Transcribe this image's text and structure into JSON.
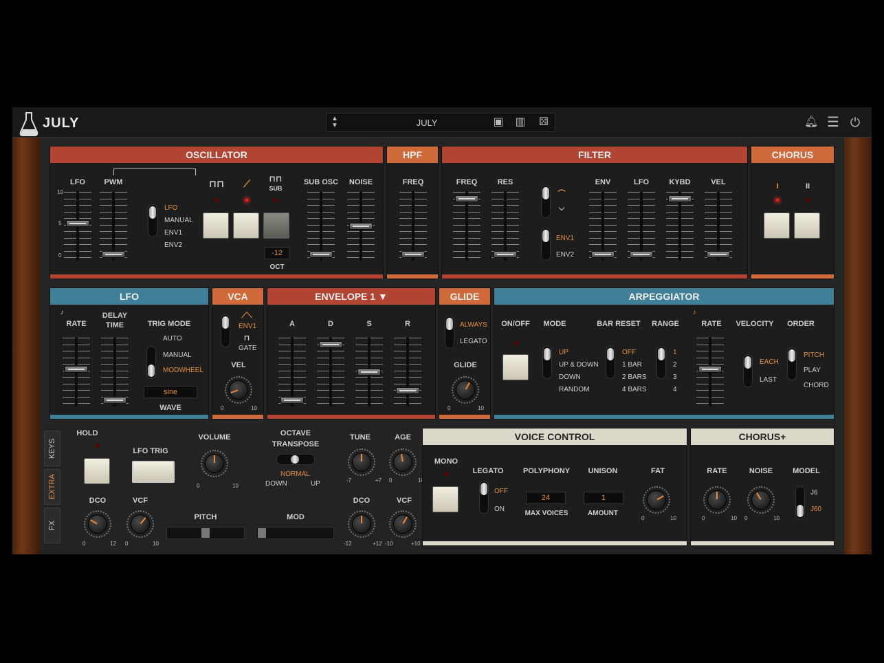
{
  "app": {
    "brand": "JULY",
    "preset_name": "JULY"
  },
  "osc": {
    "title": "OSCILLATOR",
    "lfo": "LFO",
    "pwm": "PWM",
    "sub": "SUB",
    "sub_osc": "SUB OSC",
    "noise": "NOISE",
    "src_lfo": "LFO",
    "src_manual": "MANUAL",
    "src_env1": "ENV1",
    "src_env2": "ENV2",
    "oct_value": "-12",
    "oct": "OCT",
    "n10": "10",
    "n5": "5",
    "n0": "0"
  },
  "hpf": {
    "title": "HPF",
    "freq": "FREQ"
  },
  "filter": {
    "title": "FILTER",
    "freq": "FREQ",
    "res": "RES",
    "env": "ENV",
    "lfo": "LFO",
    "kybd": "KYBD",
    "vel": "VEL",
    "env1": "ENV1",
    "env2": "ENV2"
  },
  "chorus": {
    "title": "CHORUS",
    "one": "I",
    "two": "II"
  },
  "lfo": {
    "title": "LFO",
    "rate": "RATE",
    "delay": "DELAY",
    "time": "TIME",
    "trig_mode": "TRIG MODE",
    "auto": "AUTO",
    "manual": "MANUAL",
    "modwheel": "MODWHEEL",
    "wave_value": "sine",
    "wave": "WAVE"
  },
  "vca": {
    "title": "VCA",
    "env1": "ENV1",
    "gate": "GATE",
    "vel": "VEL"
  },
  "env": {
    "title": "ENVELOPE 1",
    "a": "A",
    "d": "D",
    "s": "S",
    "r": "R"
  },
  "glide": {
    "title": "GLIDE",
    "always": "ALWAYS",
    "legato": "LEGATO",
    "glide": "GLIDE"
  },
  "arp": {
    "title": "ARPEGGIATOR",
    "onoff": "ON/OFF",
    "mode": "MODE",
    "up": "UP",
    "updown": "UP & DOWN",
    "down": "DOWN",
    "random": "RANDOM",
    "bar_reset": "BAR RESET",
    "off": "OFF",
    "bar1": "1 BAR",
    "bar2": "2 BARS",
    "bar4": "4 BARS",
    "range": "RANGE",
    "r1": "1",
    "r2": "2",
    "r3": "3",
    "r4": "4",
    "rate": "RATE",
    "velocity": "VELOCITY",
    "each": "EACH",
    "last": "LAST",
    "order": "ORDER",
    "pitch": "PITCH",
    "play": "PLAY",
    "chord": "CHORD"
  },
  "tabs": {
    "keys": "KEYS",
    "extra": "EXTRA",
    "fx": "FX"
  },
  "extra": {
    "hold": "HOLD",
    "lfo_trig": "LFO TRIG",
    "volume": "VOLUME",
    "dco": "DCO",
    "vcf": "VCF",
    "pitch": "PITCH",
    "octave": "OCTAVE",
    "transpose": "TRANSPOSE",
    "normal": "NORMAL",
    "down": "DOWN",
    "up": "UP",
    "tune": "TUNE",
    "age": "AGE",
    "mod": "MOD",
    "dco2": "DCO",
    "vcf2": "VCF",
    "n12": "12",
    "m7": "-7",
    "p7": "+7",
    "m12": "-12",
    "p12": "+12",
    "m10": "-10",
    "p10": "+10"
  },
  "voice": {
    "title": "VOICE CONTROL",
    "mono": "MONO",
    "legato": "LEGATO",
    "off": "OFF",
    "on": "ON",
    "polyphony": "POLYPHONY",
    "voices_value": "24",
    "max_voices": "MAX VOICES",
    "unison": "UNISON",
    "amount_value": "1",
    "amount": "AMOUNT",
    "fat": "FAT"
  },
  "chorusplus": {
    "title": "CHORUS+",
    "rate": "RATE",
    "noise": "NOISE",
    "model": "MODEL",
    "j6": "J6",
    "j60": "J60"
  }
}
